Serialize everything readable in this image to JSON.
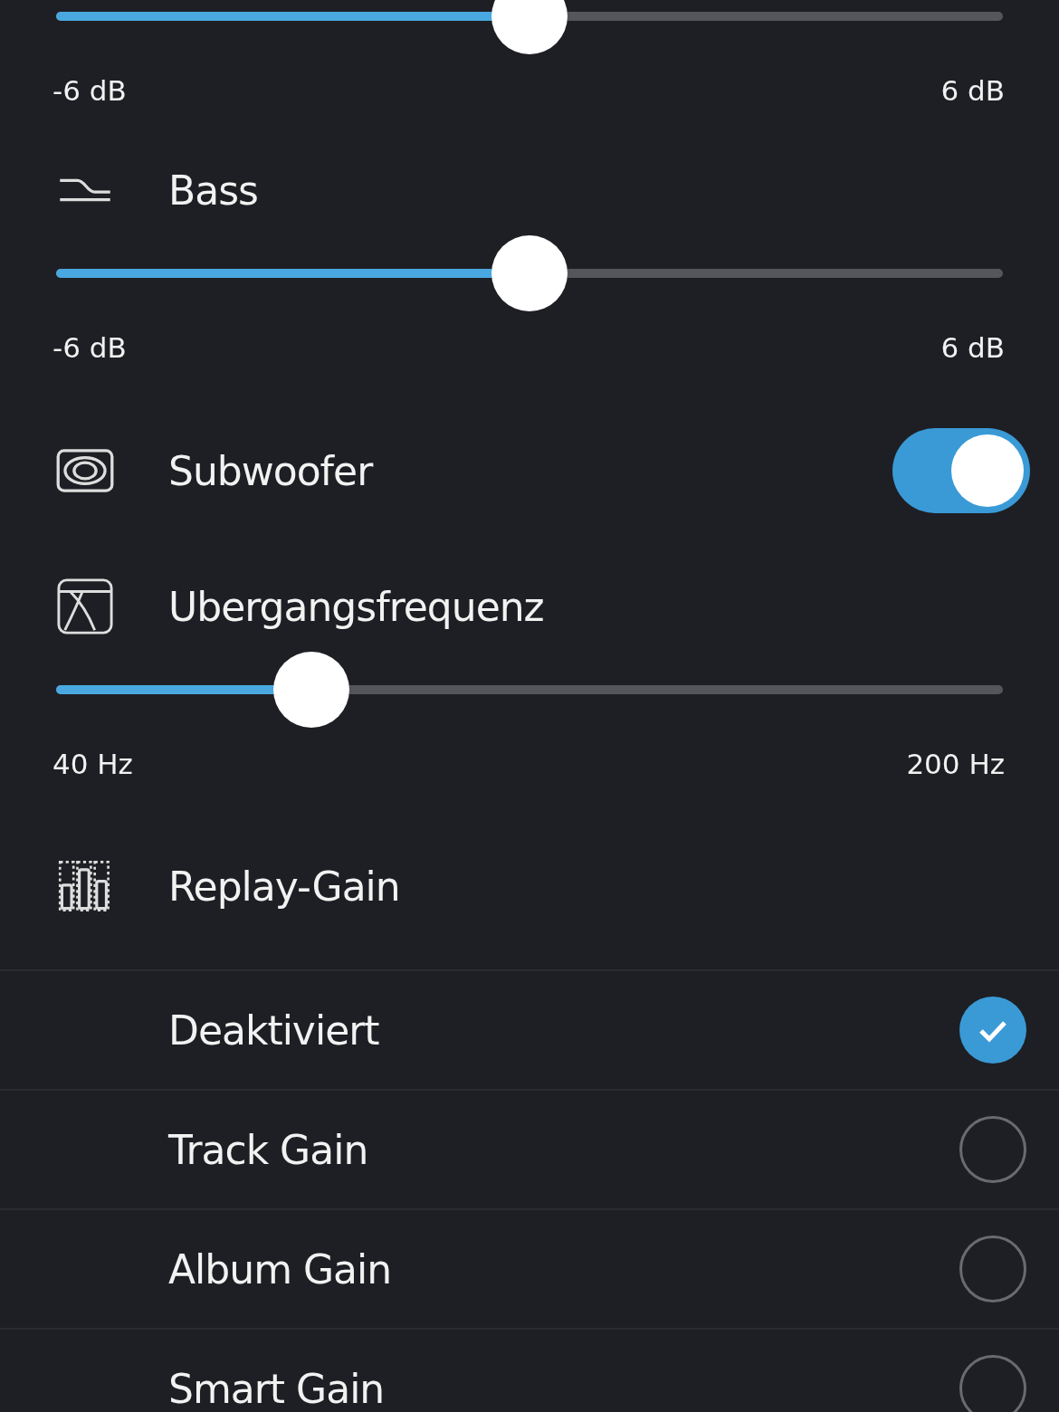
{
  "rows": [
    {
      "kind": "slider",
      "level": 0.5,
      "min_label": "-6 dB",
      "max_label": "6 dB"
    },
    {
      "kind": "heading",
      "label": "Bass"
    },
    {
      "kind": "slider",
      "level": 0.5,
      "min_label": "-6 dB",
      "max_label": "6 dB"
    },
    {
      "kind": "toggle",
      "label": "Subwoofer",
      "on": true
    },
    {
      "kind": "heading",
      "label": "Ubergangsfrequenz"
    },
    {
      "kind": "slider",
      "level": 0.27,
      "min_label": "40 Hz",
      "max_label": "200 Hz"
    }
  ],
  "replay_gain": {
    "label": "Replay-Gain",
    "options": [
      {
        "label": "Deaktiviert",
        "selected": true
      },
      {
        "label": "Track Gain",
        "selected": false
      },
      {
        "label": "Album Gain",
        "selected": false
      },
      {
        "label": "Smart Gain",
        "selected": false
      }
    ]
  }
}
